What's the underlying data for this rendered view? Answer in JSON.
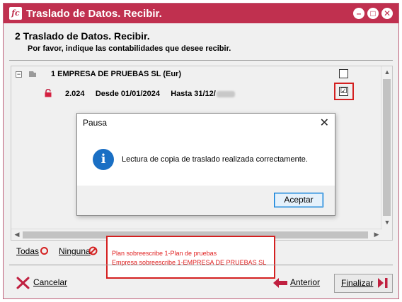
{
  "window": {
    "title": "Traslado de Datos. Recibir.",
    "controls": [
      "minimize-icon",
      "restore-icon",
      "close-icon"
    ]
  },
  "header": {
    "step_title": "2 Traslado de Datos. Recibir.",
    "instruction": "Por favor, indique las contabilidades que desee recibir."
  },
  "tree": {
    "company": {
      "label": "1 EMPRESA DE PRUEBAS SL (Eur)",
      "checked": false
    },
    "year": {
      "year": "2.024",
      "from": "Desde 01/01/2024",
      "to": "Hasta 31/12/",
      "checked": true
    }
  },
  "selection": {
    "all": "Todas",
    "none": "Ninguna"
  },
  "messages": [
    "Plan sobreescribe 1-Plan de pruebas",
    "Empresa sobreescribe 1-EMPRESA DE PRUEBAS SL"
  ],
  "footer": {
    "cancel": "Cancelar",
    "previous": "Anterior",
    "finish": "Finalizar"
  },
  "dialog": {
    "title": "Pausa",
    "message": "Lectura de copia de traslado realizada correctamente.",
    "accept": "Aceptar"
  },
  "colors": {
    "titlebar": "#c0304f",
    "highlight_red": "#d42020",
    "info_blue": "#1a6fc4"
  }
}
